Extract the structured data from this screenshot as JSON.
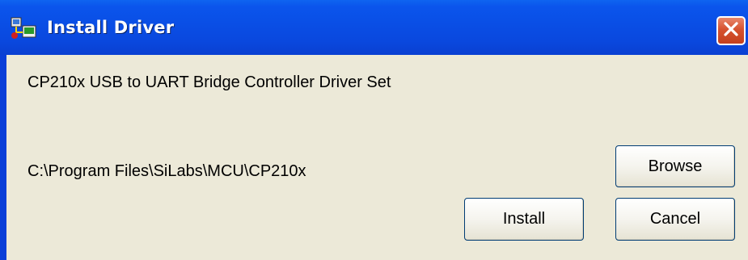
{
  "window": {
    "title": "Install Driver",
    "icon": "install-driver-icon",
    "close_icon": "close-icon"
  },
  "content": {
    "description": "CP210x USB to UART Bridge Controller Driver Set",
    "install_path": "C:\\Program Files\\SiLabs\\MCU\\CP210x"
  },
  "buttons": {
    "browse": "Browse",
    "install": "Install",
    "cancel": "Cancel"
  },
  "colors": {
    "titlebar": "#0a4fe6",
    "client_background": "#ece9d8",
    "close_button": "#d6522f"
  }
}
